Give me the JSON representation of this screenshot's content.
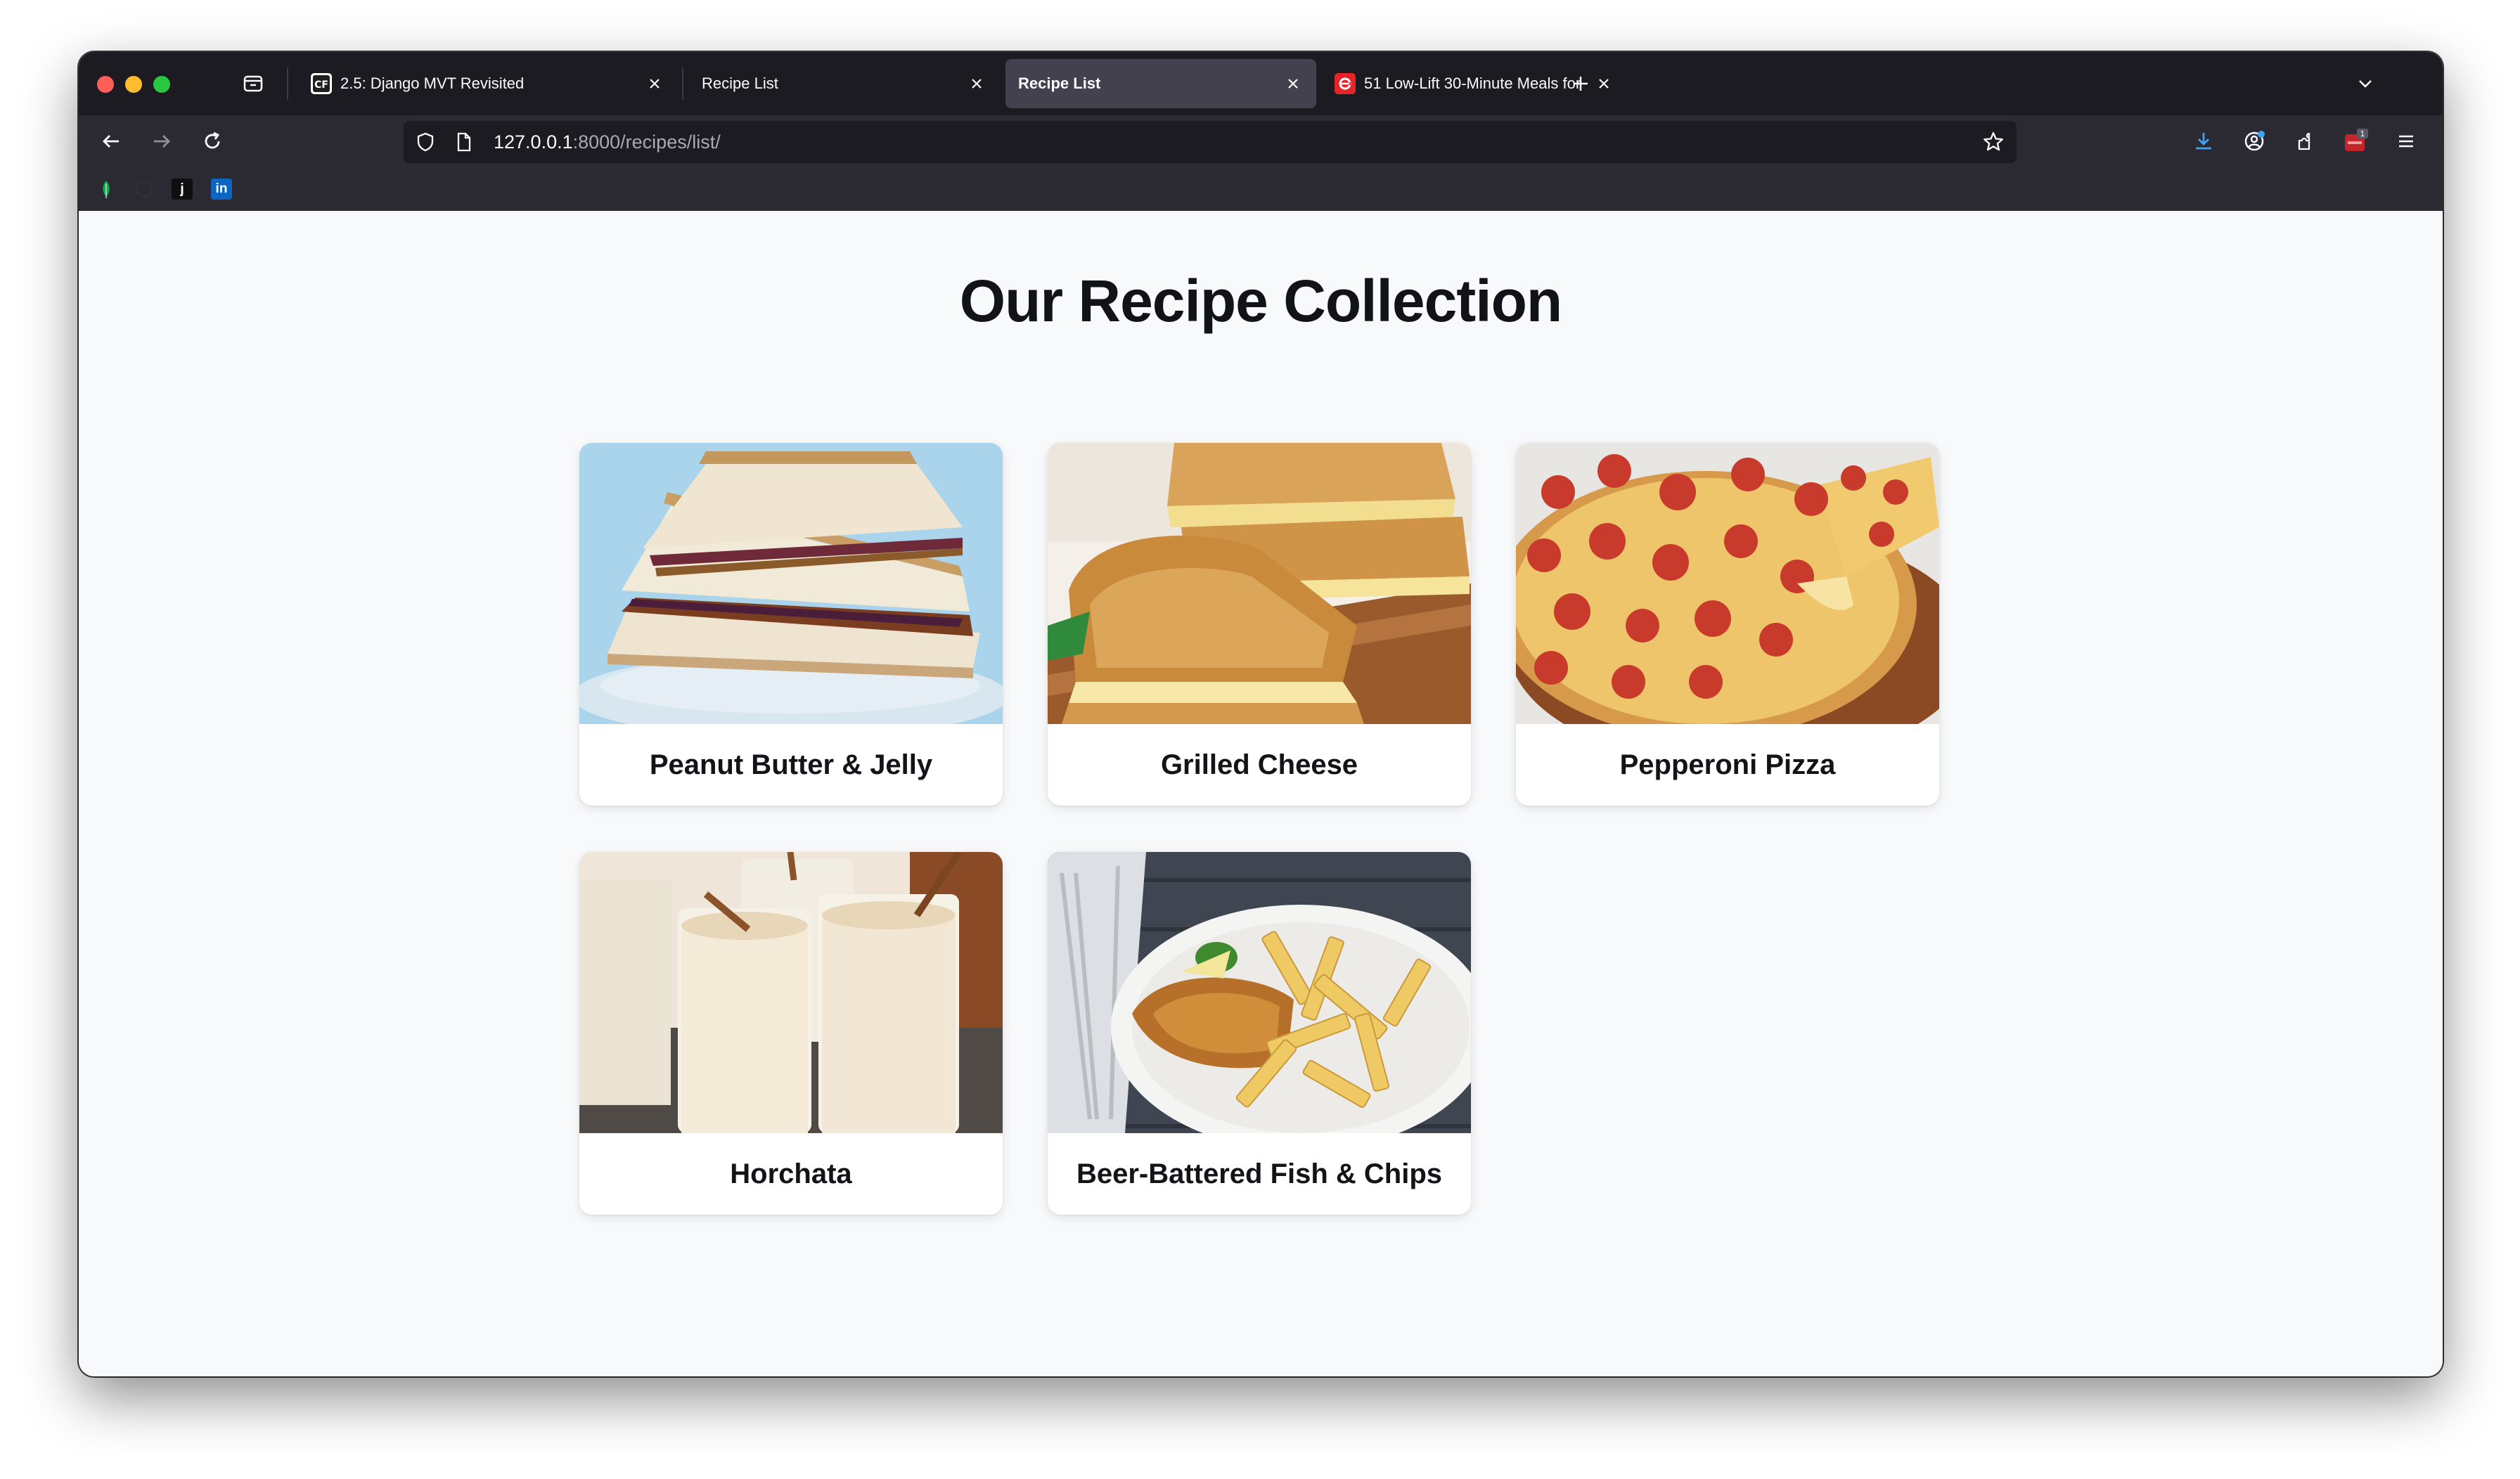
{
  "browser": {
    "tabs": [
      {
        "title": "2.5: Django MVT Revisited",
        "favicon": "cf-icon",
        "active": false
      },
      {
        "title": "Recipe List",
        "favicon": "none",
        "active": false
      },
      {
        "title": "Recipe List",
        "favicon": "none",
        "active": true
      },
      {
        "title": "51 Low-Lift 30-Minute Meals for",
        "favicon": "epicurious-icon",
        "active": false
      }
    ],
    "url_host": "127.0.0.1",
    "url_rest": ":8000/recipes/list/",
    "bookmarks": [
      {
        "icon": "mongodb-leaf-icon",
        "label": ""
      },
      {
        "icon": "github-icon",
        "label": ""
      },
      {
        "icon": "j-icon",
        "label": "j"
      },
      {
        "icon": "linkedin-icon",
        "label": "in"
      }
    ],
    "extension_badge": "1"
  },
  "page": {
    "title": "Our Recipe Collection",
    "recipes": [
      {
        "name": "Peanut Butter & Jelly",
        "image": "pbj-sandwich-photo"
      },
      {
        "name": "Grilled Cheese",
        "image": "grilled-cheese-photo"
      },
      {
        "name": "Pepperoni Pizza",
        "image": "pepperoni-pizza-photo"
      },
      {
        "name": "Horchata",
        "image": "horchata-photo"
      },
      {
        "name": "Beer-Battered Fish & Chips",
        "image": "fish-and-chips-photo"
      }
    ]
  },
  "colors": {
    "tab_bar": "#1c1b22",
    "nav_bar": "#2b2a33",
    "active_tab": "#42414d",
    "page_background": "#f8f9fb"
  }
}
